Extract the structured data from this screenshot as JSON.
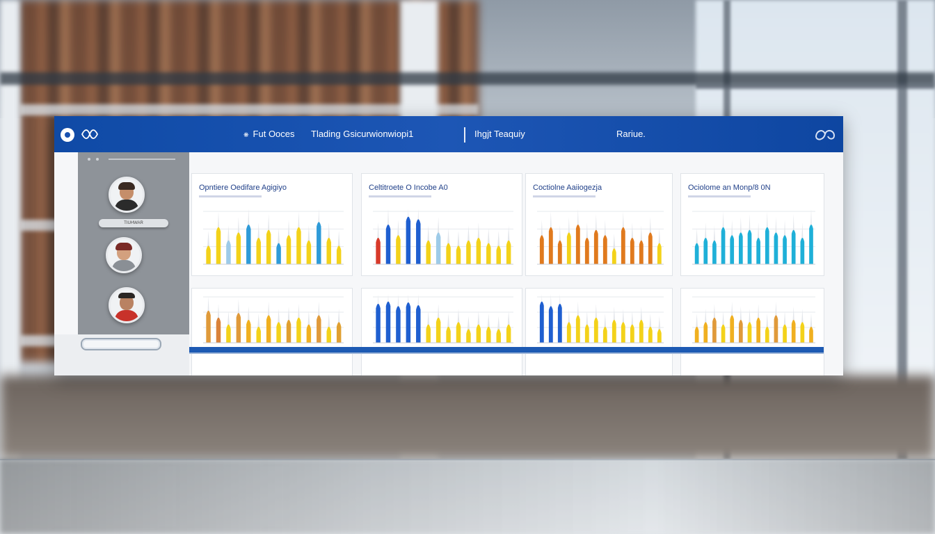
{
  "nav": {
    "item1": "Fut Ooces",
    "item2": "Tlading Gsicurwionwiopi1",
    "item3": "Ihgjt Teaquiy",
    "item4": "Rariue."
  },
  "sidebar": {
    "name_tag": "TIUHWAR"
  },
  "cards": [
    {
      "title": "Opntiere Oedifare Agigiyo"
    },
    {
      "title": "Celtitroete O Incobe A0"
    },
    {
      "title": "Coctiolne Aaiiogezja"
    },
    {
      "title": "Ociolome an Monp/8 0N"
    },
    {
      "title": ""
    },
    {
      "title": ""
    },
    {
      "title": ""
    },
    {
      "title": ""
    }
  ],
  "colors": {
    "brand_blue": "#1a52b0",
    "yellow": "#f3d21a",
    "blue": "#1f5fd0",
    "orange": "#e07a1e",
    "cyan": "#1fb0d8"
  },
  "chart_bars": [
    {
      "palette": [
        "#f3d21a",
        "#f3d21a",
        "#9ecbe8",
        "#f3d21a",
        "#2f9bd8",
        "#f3d21a",
        "#f3d21a",
        "#2f9bd8",
        "#f3d21a",
        "#f3d21a",
        "#f3d21a",
        "#2f9bd8",
        "#f3d21a",
        "#f3d21a"
      ],
      "values": [
        0.35,
        0.7,
        0.45,
        0.6,
        0.75,
        0.5,
        0.65,
        0.4,
        0.55,
        0.7,
        0.45,
        0.8,
        0.5,
        0.35
      ]
    },
    {
      "palette": [
        "#d83a2a",
        "#1f5fd0",
        "#f3d21a",
        "#1f5fd0",
        "#1f5fd0",
        "#f3d21a",
        "#9ecbe8",
        "#f3d21a",
        "#f3d21a",
        "#f3d21a",
        "#f3d21a",
        "#f3d21a",
        "#f3d21a",
        "#f3d21a"
      ],
      "values": [
        0.5,
        0.75,
        0.55,
        0.9,
        0.85,
        0.45,
        0.6,
        0.4,
        0.35,
        0.45,
        0.5,
        0.4,
        0.35,
        0.45
      ]
    },
    {
      "palette": [
        "#e07a1e",
        "#e07a1e",
        "#e07a1e",
        "#f3d21a",
        "#e07a1e",
        "#e07a1e",
        "#e07a1e",
        "#e07a1e",
        "#f3d21a",
        "#e07a1e",
        "#e07a1e",
        "#e07a1e",
        "#e07a1e",
        "#f3d21a"
      ],
      "values": [
        0.55,
        0.7,
        0.45,
        0.6,
        0.75,
        0.5,
        0.65,
        0.55,
        0.3,
        0.7,
        0.5,
        0.45,
        0.6,
        0.4
      ]
    },
    {
      "palette": [
        "#1fb0d8",
        "#1fb0d8",
        "#1fb0d8",
        "#1fb0d8",
        "#1fb0d8",
        "#1fb0d8",
        "#1fb0d8",
        "#1fb0d8",
        "#1fb0d8",
        "#1fb0d8",
        "#1fb0d8",
        "#1fb0d8",
        "#1fb0d8",
        "#1fb0d8"
      ],
      "values": [
        0.4,
        0.5,
        0.45,
        0.7,
        0.55,
        0.6,
        0.65,
        0.5,
        0.7,
        0.6,
        0.55,
        0.65,
        0.5,
        0.75
      ]
    },
    {
      "palette": [
        "#e09a3a",
        "#d9823a",
        "#f3d21a",
        "#e09a3a",
        "#f0b020",
        "#f3d21a",
        "#f0b020",
        "#f3d21a",
        "#e0a030",
        "#f3d21a",
        "#f0b020",
        "#e09a3a",
        "#f3d21a",
        "#e0a030"
      ],
      "values": [
        0.7,
        0.55,
        0.4,
        0.65,
        0.5,
        0.35,
        0.6,
        0.45,
        0.5,
        0.55,
        0.4,
        0.6,
        0.35,
        0.45
      ]
    },
    {
      "palette": [
        "#1f5fd0",
        "#1f5fd0",
        "#1f5fd0",
        "#1f5fd0",
        "#1f5fd0",
        "#f3d21a",
        "#f3d21a",
        "#f3d21a",
        "#f3d21a",
        "#f3d21a",
        "#f3d21a",
        "#f3d21a",
        "#f3d21a",
        "#f3d21a"
      ],
      "values": [
        0.85,
        0.9,
        0.8,
        0.88,
        0.82,
        0.4,
        0.55,
        0.35,
        0.45,
        0.3,
        0.4,
        0.35,
        0.3,
        0.4
      ]
    },
    {
      "palette": [
        "#1f5fd0",
        "#1f5fd0",
        "#1f5fd0",
        "#f3d21a",
        "#f3d21a",
        "#f3d21a",
        "#f3d21a",
        "#f3d21a",
        "#f3d21a",
        "#f3d21a",
        "#f3d21a",
        "#f3d21a",
        "#f3d21a",
        "#f3d21a"
      ],
      "values": [
        0.9,
        0.8,
        0.85,
        0.45,
        0.6,
        0.4,
        0.55,
        0.35,
        0.5,
        0.45,
        0.4,
        0.5,
        0.35,
        0.3
      ]
    },
    {
      "palette": [
        "#f0b020",
        "#f0b020",
        "#e09a3a",
        "#f3d21a",
        "#f0b020",
        "#e09a3a",
        "#f3d21a",
        "#f0b020",
        "#f3d21a",
        "#e09a3a",
        "#f3d21a",
        "#f0b020",
        "#f3d21a",
        "#f0b020"
      ],
      "values": [
        0.35,
        0.45,
        0.55,
        0.4,
        0.6,
        0.5,
        0.45,
        0.55,
        0.35,
        0.6,
        0.4,
        0.5,
        0.45,
        0.35
      ]
    }
  ]
}
